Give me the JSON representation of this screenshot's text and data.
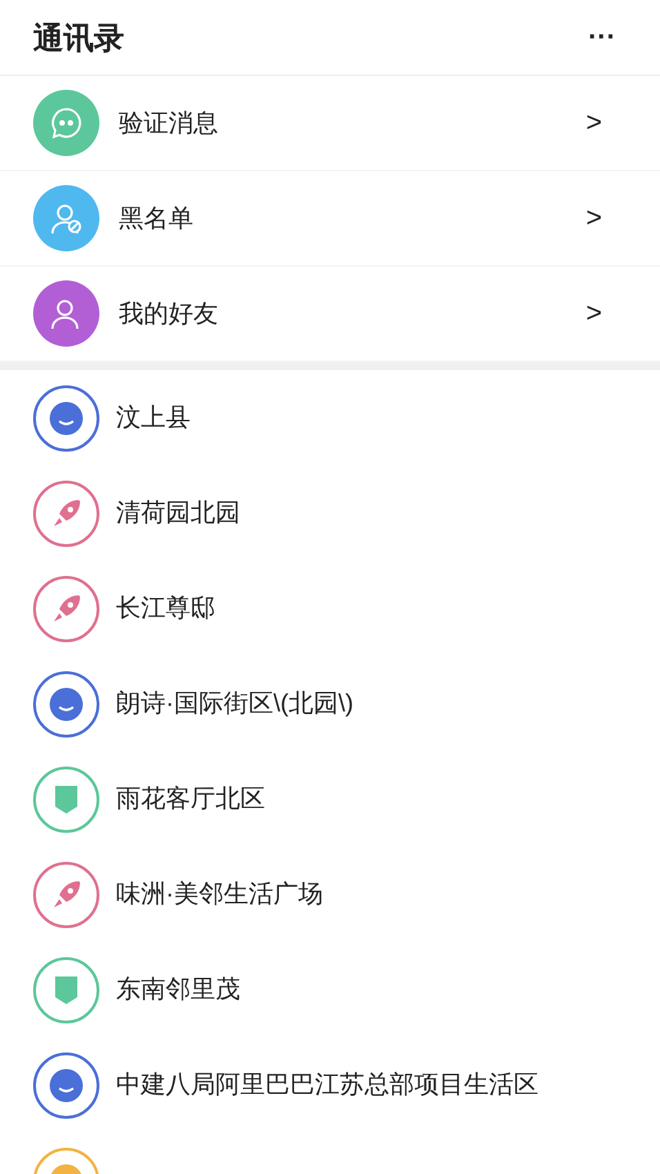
{
  "header": {
    "title": "通讯录",
    "more": "···"
  },
  "shortcuts": [
    {
      "kind": "message",
      "label": "验证消息",
      "arrow": ">"
    },
    {
      "kind": "blocked",
      "label": "黑名单",
      "arrow": ">"
    },
    {
      "kind": "friends",
      "label": "我的好友",
      "arrow": ">"
    }
  ],
  "groups": [
    {
      "kind": "smile",
      "name": "汶上县"
    },
    {
      "kind": "rocket",
      "name": "清荷园北园"
    },
    {
      "kind": "rocket",
      "name": "长江尊邸"
    },
    {
      "kind": "smile",
      "name": "朗诗·国际街区\\(北园\\)"
    },
    {
      "kind": "shield",
      "name": "雨花客厅北区"
    },
    {
      "kind": "rocket",
      "name": "味洲·美邻生活广场"
    },
    {
      "kind": "shield",
      "name": "东南邻里茂"
    },
    {
      "kind": "smile",
      "name": "中建八局阿里巴巴江苏总部项目生活区"
    },
    {
      "kind": "sun"
    }
  ]
}
